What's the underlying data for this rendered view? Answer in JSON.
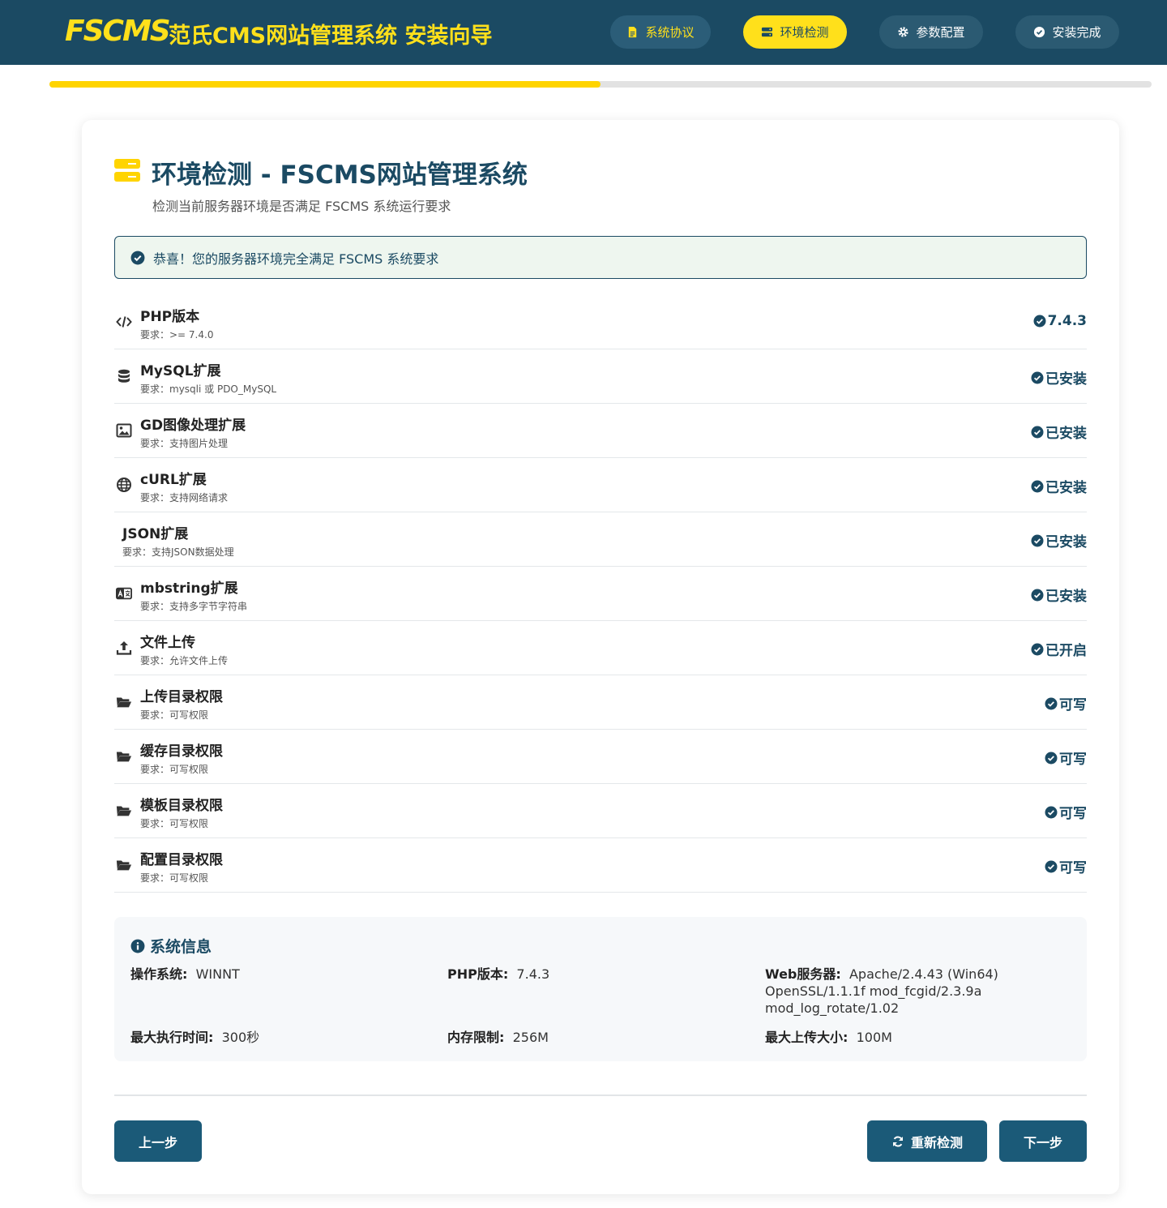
{
  "header": {
    "logo": "FSCMS",
    "title": "范氏CMS网站管理系统 安装向导",
    "steps": [
      {
        "label": "系统协议",
        "icon": "file-contract-icon",
        "state": "done"
      },
      {
        "label": "环境检测",
        "icon": "server-icon",
        "state": "active"
      },
      {
        "label": "参数配置",
        "icon": "gear-icon",
        "state": "todo"
      },
      {
        "label": "安装完成",
        "icon": "check-circle-icon",
        "state": "todo"
      }
    ]
  },
  "progress": {
    "fraction": 0.5
  },
  "page": {
    "title": "环境检测 - FSCMS网站管理系统",
    "subtitle": "检测当前服务器环境是否满足 FSCMS 系统运行要求"
  },
  "alert": {
    "message": "恭喜！您的服务器环境完全满足 FSCMS 系统要求"
  },
  "checks": [
    {
      "name": "PHP版本",
      "requirement": "要求：>= 7.4.0",
      "status": "7.4.3",
      "icon": "code-icon"
    },
    {
      "name": "MySQL扩展",
      "requirement": "要求：mysqli 或 PDO_MySQL",
      "status": "已安装",
      "icon": "database-icon"
    },
    {
      "name": "GD图像处理扩展",
      "requirement": "要求：支持图片处理",
      "status": "已安装",
      "icon": "image-icon"
    },
    {
      "name": "cURL扩展",
      "requirement": "要求：支持网络请求",
      "status": "已安装",
      "icon": "globe-icon"
    },
    {
      "name": "JSON扩展",
      "requirement": "要求：支持JSON数据处理",
      "status": "已安装",
      "icon": ""
    },
    {
      "name": "mbstring扩展",
      "requirement": "要求：支持多字节字符串",
      "status": "已安装",
      "icon": "language-icon"
    },
    {
      "name": "文件上传",
      "requirement": "要求：允许文件上传",
      "status": "已开启",
      "icon": "upload-icon"
    },
    {
      "name": "上传目录权限",
      "requirement": "要求：可写权限",
      "status": "可写",
      "icon": "folder-open-icon"
    },
    {
      "name": "缓存目录权限",
      "requirement": "要求：可写权限",
      "status": "可写",
      "icon": "folder-open-icon"
    },
    {
      "name": "模板目录权限",
      "requirement": "要求：可写权限",
      "status": "可写",
      "icon": "folder-open-icon"
    },
    {
      "name": "配置目录权限",
      "requirement": "要求：可写权限",
      "status": "可写",
      "icon": "folder-open-icon"
    }
  ],
  "sysinfo": {
    "title": "系统信息",
    "os": {
      "label": "操作系统:",
      "value": "WINNT"
    },
    "php": {
      "label": "PHP版本:",
      "value": "7.4.3"
    },
    "web": {
      "label": "Web服务器:",
      "value": "Apache/2.4.43 (Win64) OpenSSL/1.1.1f mod_fcgid/2.3.9a mod_log_rotate/1.02"
    },
    "max_exec": {
      "label": "最大执行时间:",
      "value": "300秒"
    },
    "memory": {
      "label": "内存限制:",
      "value": "256M"
    },
    "upload": {
      "label": "最大上传大小:",
      "value": "100M"
    }
  },
  "buttons": {
    "prev": "上一步",
    "recheck": "重新检测",
    "next": "下一步"
  },
  "colors": {
    "primary": "#1b4a63",
    "accent": "#ffe01b",
    "success_bg": "#eef6ef"
  }
}
